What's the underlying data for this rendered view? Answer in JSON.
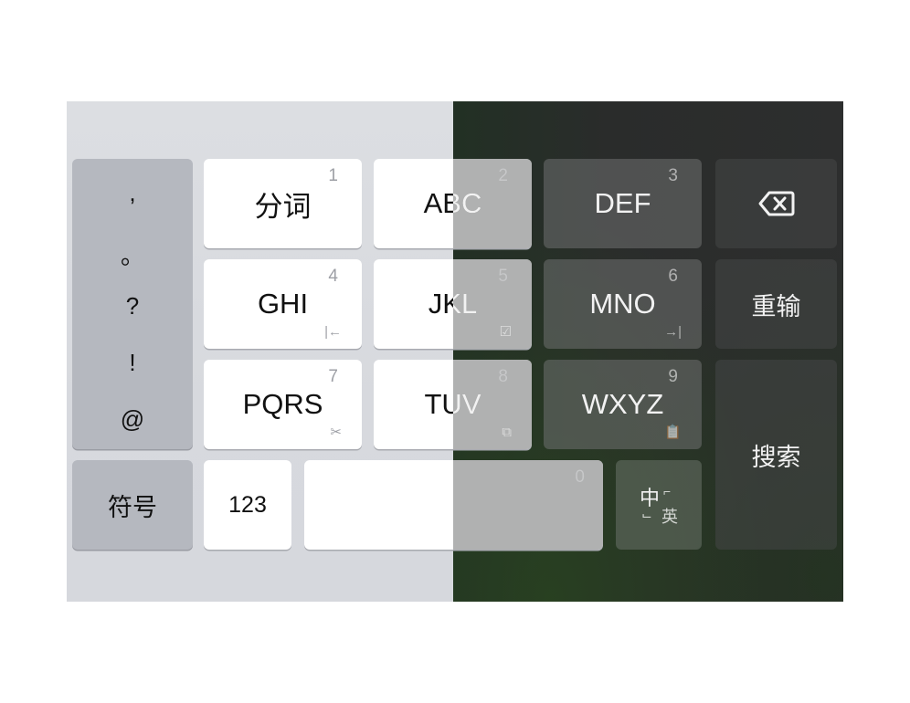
{
  "keyboard": {
    "symbols": [
      ",",
      "。",
      "?",
      "!",
      "@"
    ],
    "symbols_key": "符号",
    "num_key": "123",
    "space_num": "0",
    "lang_primary": "中",
    "lang_secondary": "英",
    "search_key": "搜索",
    "reinput_key": "重输",
    "backspace_icon": "backspace-icon",
    "keys": [
      {
        "label": "分词",
        "num": "1",
        "sub": ""
      },
      {
        "label": "ABC",
        "num": "2",
        "sub": ""
      },
      {
        "label": "DEF",
        "num": "3",
        "sub": ""
      },
      {
        "label": "GHI",
        "num": "4",
        "sub": "|←"
      },
      {
        "label": "JKL",
        "num": "5",
        "sub": "☑"
      },
      {
        "label": "MNO",
        "num": "6",
        "sub": "→|"
      },
      {
        "label": "PQRS",
        "num": "7",
        "sub": "✂"
      },
      {
        "label": "TUV",
        "num": "8",
        "sub": "⧉"
      },
      {
        "label": "WXYZ",
        "num": "9",
        "sub": "📋"
      }
    ]
  },
  "colors": {
    "light_bg": "#d9dbe0",
    "dark_bg": "#2c2e2d",
    "key_white": "#ffffff",
    "key_gray": "#b5b8bf"
  }
}
